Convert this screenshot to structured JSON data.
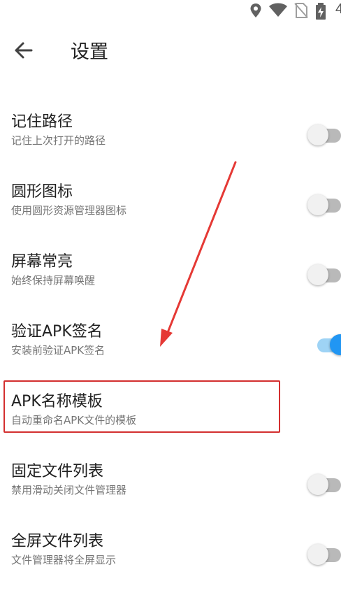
{
  "status_bar": {
    "icons": [
      "location-icon",
      "wifi-icon",
      "no-sim-icon",
      "battery-charging-icon"
    ],
    "battery_text": "4"
  },
  "app_bar": {
    "title": "设置",
    "back_icon": "arrow-left-icon"
  },
  "settings": [
    {
      "title": "记住路径",
      "subtitle": "记住上次打开的路径",
      "toggle": "off"
    },
    {
      "title": "圆形图标",
      "subtitle": "使用圆形资源管理器图标",
      "toggle": "off"
    },
    {
      "title": "屏幕常亮",
      "subtitle": "始终保持屏幕唤醒",
      "toggle": "off"
    },
    {
      "title": "验证APK签名",
      "subtitle": "安装前验证APK签名",
      "toggle": "on"
    },
    {
      "title": "APK名称模板",
      "subtitle": "自动重命名APK文件的模板"
    },
    {
      "title": "固定文件列表",
      "subtitle": "禁用滑动关闭文件管理器",
      "toggle": "off"
    },
    {
      "title": "全屏文件列表",
      "subtitle": "文件管理器将全屏显示",
      "toggle": "off"
    }
  ],
  "annotation": {
    "highlight_color": "#d32f2f",
    "arrow_color": "#e53935"
  },
  "colors": {
    "accent": "#2196f3",
    "text_primary": "#212121",
    "text_secondary": "#757575"
  }
}
